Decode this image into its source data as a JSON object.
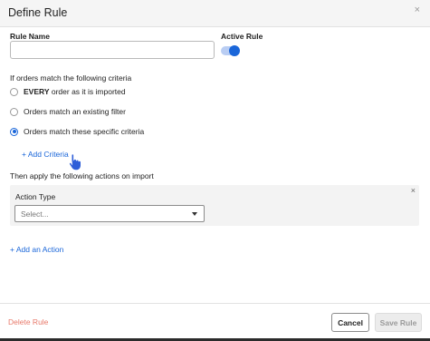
{
  "dialog": {
    "title": "Define Rule",
    "close_glyph": "×"
  },
  "form": {
    "rule_name_label": "Rule Name",
    "rule_name_value": "",
    "active_rule_label": "Active Rule",
    "active_rule_on": true
  },
  "criteria": {
    "heading": "If orders match the following criteria",
    "options": [
      {
        "bold": "EVERY",
        "rest": " order as it is imported",
        "checked": false
      },
      {
        "bold": "",
        "rest": "Orders match an existing filter",
        "checked": false
      },
      {
        "bold": "",
        "rest": "Orders match these specific criteria",
        "checked": true
      }
    ],
    "add_criteria_label": "+ Add Criteria"
  },
  "actions": {
    "heading": "Then apply the following actions on import",
    "panel_close_glyph": "×",
    "action_type_label": "Action Type",
    "select_placeholder": "Select...",
    "add_action_label": "+ Add an Action"
  },
  "footer": {
    "delete_label": "Delete Rule",
    "cancel_label": "Cancel",
    "save_label": "Save Rule"
  },
  "colors": {
    "accent": "#1a66d9",
    "delete": "#e8796a"
  },
  "icons": {
    "close": "close-icon",
    "caret": "chevron-down-icon",
    "cursor": "hand-pointer-icon"
  }
}
